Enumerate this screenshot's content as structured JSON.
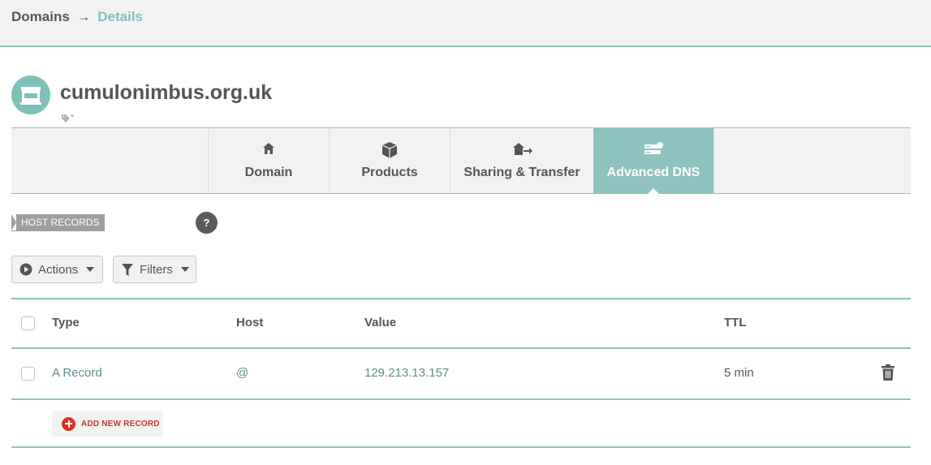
{
  "breadcrumb": {
    "parent": "Domains",
    "separator": "→",
    "current": "Details"
  },
  "domain": {
    "name": "cumulonimbus.org.uk",
    "avatar_icon": "store-icon",
    "tag_icon": "add-tag-icon"
  },
  "tabs": [
    {
      "label": "Domain",
      "icon": "home-icon",
      "active": false
    },
    {
      "label": "Products",
      "icon": "box-icon",
      "active": false
    },
    {
      "label": "Sharing & Transfer",
      "icon": "home-transfer-icon",
      "active": false
    },
    {
      "label": "Advanced DNS",
      "icon": "server-icon",
      "active": true
    }
  ],
  "section": {
    "label": "HOST RECORDS",
    "help": "?"
  },
  "toolbar": {
    "actions_label": "Actions",
    "filters_label": "Filters"
  },
  "table": {
    "columns": [
      "Type",
      "Host",
      "Value",
      "TTL"
    ],
    "rows": [
      {
        "type": "A Record",
        "host": "@",
        "value": "129.213.13.157",
        "ttl": "5 min"
      }
    ]
  },
  "add_record_label": "ADD NEW RECORD",
  "colors": {
    "accent": "#8fc3bf",
    "danger": "#d9342b"
  }
}
